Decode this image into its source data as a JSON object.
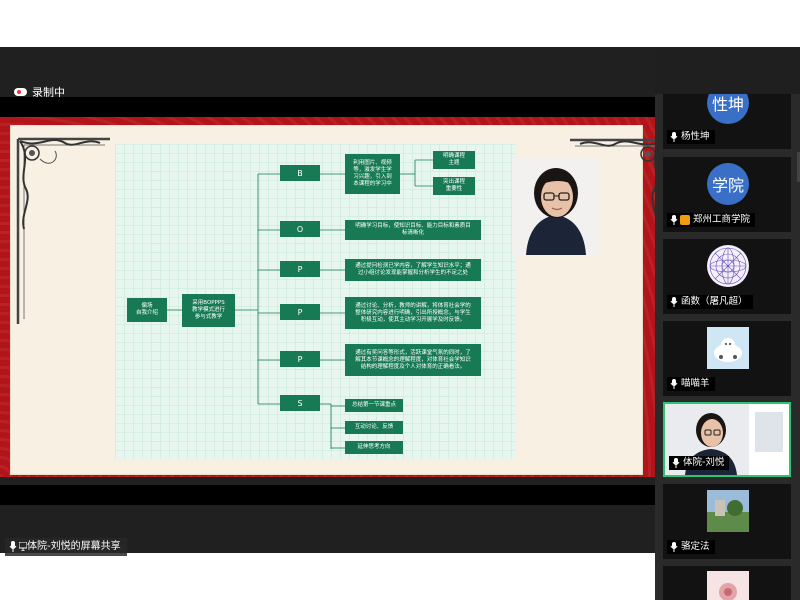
{
  "recording": {
    "label": "录制中"
  },
  "share": {
    "label": "体院-刘悦的屏幕共享"
  },
  "mindmap": {
    "root": "偏场\n自我介绍",
    "method": "采用BOPPPS\n教学模式进行\n参与式教学",
    "branches": [
      {
        "letter": "B",
        "text": "利用图片、视频\n等，激发学生学\n习兴趣，引入到\n本课程的学习中"
      },
      {
        "letter": "O",
        "text": "明确学习目标，使知识目标、能力目标和素质目\n标清晰化"
      },
      {
        "letter": "P",
        "text": "通过提问检测已学内容，了解学生知识水平；通\n过小组讨论发现能掌握和分析学生的不足之处"
      },
      {
        "letter": "P",
        "text": "通过讨论、分析，教师的讲解，将体育社会学的\n整体研究内容进行明确，引出所授概念，与学生\n积极互动，使其主动学习开展学及时反馈。"
      },
      {
        "letter": "P",
        "text": "通过有奖问答等形式，活跃课堂气氛的同时，了\n解其本节课概念的理解程度，对体育社会学知识\n结构的理解程度及个人对体育的正确看法。"
      },
      {
        "letter": "S",
        "text": ""
      }
    ],
    "b_leaves": [
      "明确课程\n主题",
      "突出课程\n重要性"
    ],
    "s_leaves": [
      "总结第一节课重点",
      "互动讨论、反馈",
      "延伸思考方向"
    ]
  },
  "participants": [
    {
      "name": "杨性坤",
      "avatar_text": "性坤"
    },
    {
      "name": "郑州工商学院",
      "avatar_text": "学院"
    },
    {
      "name": "函数（屠凡超）"
    },
    {
      "name": "喵喵羊"
    },
    {
      "name": "体院-刘悦"
    },
    {
      "name": "骆定法"
    },
    {
      "name": ""
    }
  ],
  "colors": {
    "node_green": "#177a55",
    "slide_red": "#b3141a",
    "active_border": "#2ec473",
    "avatar_blue": "#3a6fc8"
  }
}
